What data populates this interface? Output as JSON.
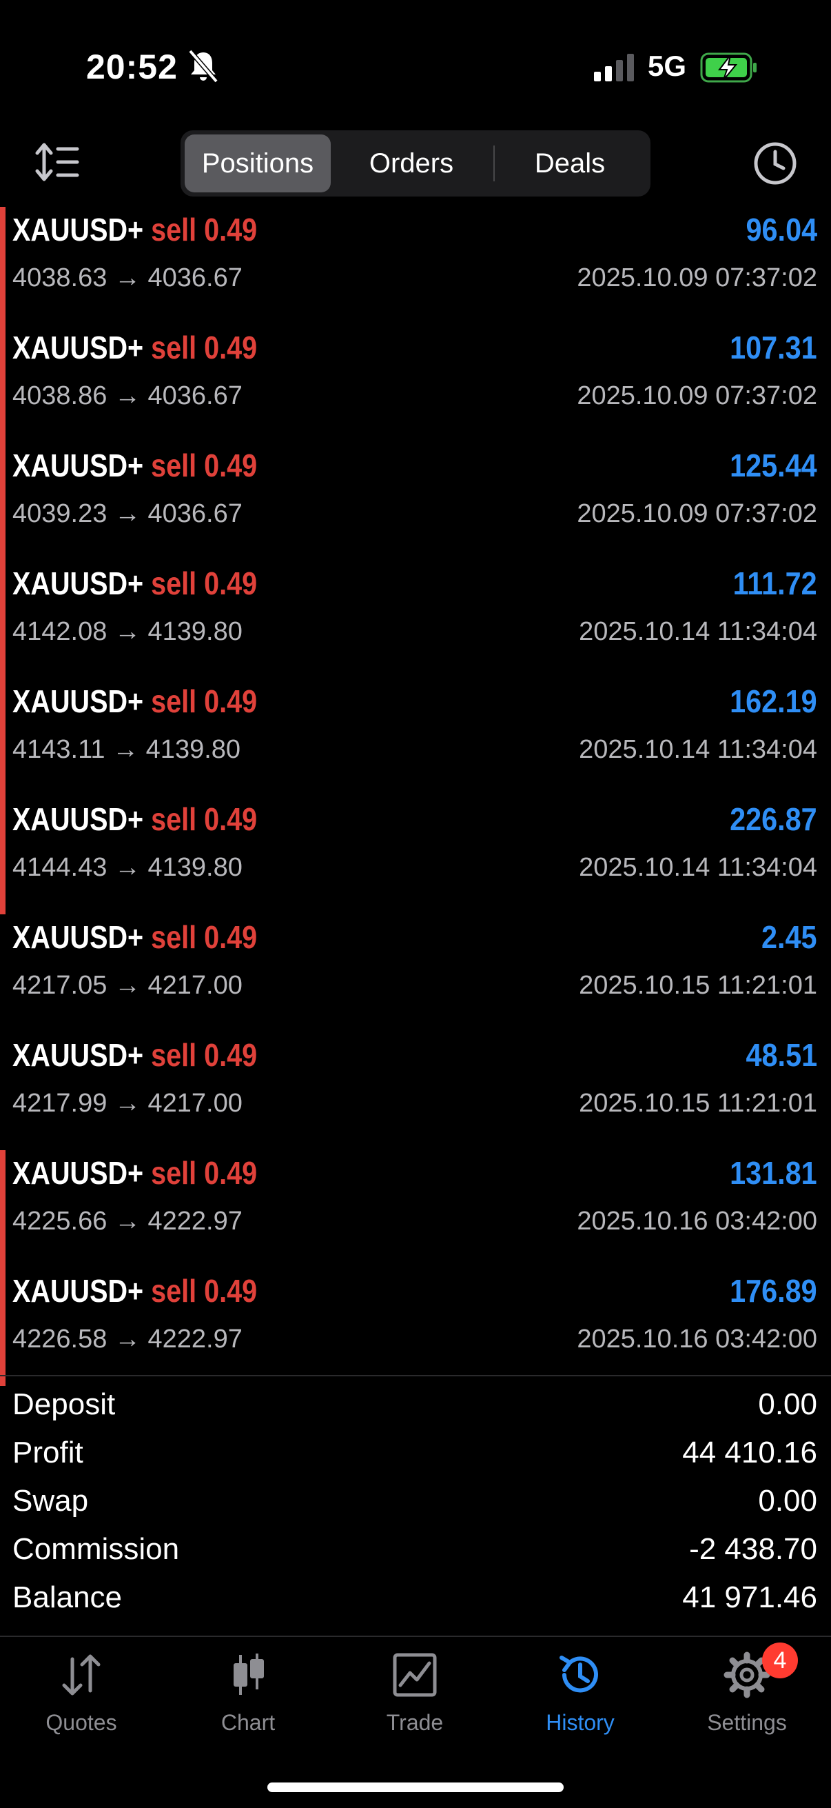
{
  "status_bar": {
    "time": "20:52",
    "network": "5G"
  },
  "toolbar": {
    "tabs": [
      "Positions",
      "Orders",
      "Deals"
    ],
    "active_tab": "Positions"
  },
  "deals": [
    {
      "symbol": "XAUUSD+",
      "side": "sell",
      "volume": "0.49",
      "open": "4038.63",
      "close": "4036.67",
      "profit": "96.04",
      "datetime": "2025.10.09 07:37:02",
      "marked": true
    },
    {
      "symbol": "XAUUSD+",
      "side": "sell",
      "volume": "0.49",
      "open": "4038.86",
      "close": "4036.67",
      "profit": "107.31",
      "datetime": "2025.10.09 07:37:02",
      "marked": true
    },
    {
      "symbol": "XAUUSD+",
      "side": "sell",
      "volume": "0.49",
      "open": "4039.23",
      "close": "4036.67",
      "profit": "125.44",
      "datetime": "2025.10.09 07:37:02",
      "marked": true
    },
    {
      "symbol": "XAUUSD+",
      "side": "sell",
      "volume": "0.49",
      "open": "4142.08",
      "close": "4139.80",
      "profit": "111.72",
      "datetime": "2025.10.14 11:34:04",
      "marked": true
    },
    {
      "symbol": "XAUUSD+",
      "side": "sell",
      "volume": "0.49",
      "open": "4143.11",
      "close": "4139.80",
      "profit": "162.19",
      "datetime": "2025.10.14 11:34:04",
      "marked": true
    },
    {
      "symbol": "XAUUSD+",
      "side": "sell",
      "volume": "0.49",
      "open": "4144.43",
      "close": "4139.80",
      "profit": "226.87",
      "datetime": "2025.10.14 11:34:04",
      "marked": true
    },
    {
      "symbol": "XAUUSD+",
      "side": "sell",
      "volume": "0.49",
      "open": "4217.05",
      "close": "4217.00",
      "profit": "2.45",
      "datetime": "2025.10.15 11:21:01",
      "marked": false
    },
    {
      "symbol": "XAUUSD+",
      "side": "sell",
      "volume": "0.49",
      "open": "4217.99",
      "close": "4217.00",
      "profit": "48.51",
      "datetime": "2025.10.15 11:21:01",
      "marked": false
    },
    {
      "symbol": "XAUUSD+",
      "side": "sell",
      "volume": "0.49",
      "open": "4225.66",
      "close": "4222.97",
      "profit": "131.81",
      "datetime": "2025.10.16 03:42:00",
      "marked": true
    },
    {
      "symbol": "XAUUSD+",
      "side": "sell",
      "volume": "0.49",
      "open": "4226.58",
      "close": "4222.97",
      "profit": "176.89",
      "datetime": "2025.10.16 03:42:00",
      "marked": true
    }
  ],
  "arrow": "→",
  "summary": [
    {
      "label": "Deposit",
      "value": "0.00"
    },
    {
      "label": "Profit",
      "value": "44 410.16"
    },
    {
      "label": "Swap",
      "value": "0.00"
    },
    {
      "label": "Commission",
      "value": "-2 438.70"
    },
    {
      "label": "Balance",
      "value": "41 971.46"
    }
  ],
  "tabbar": {
    "items": [
      {
        "label": "Quotes",
        "icon": "quotes-arrows-icon"
      },
      {
        "label": "Chart",
        "icon": "candlestick-icon"
      },
      {
        "label": "Trade",
        "icon": "trade-chart-icon"
      },
      {
        "label": "History",
        "icon": "history-clock-icon"
      },
      {
        "label": "Settings",
        "icon": "gear-icon"
      }
    ],
    "active": "History",
    "settings_badge": "4"
  },
  "colors": {
    "sell": "#e0413a",
    "profit": "#2f8ef5",
    "active_tab": "#2f8ef5",
    "badge": "#ff3b30"
  }
}
